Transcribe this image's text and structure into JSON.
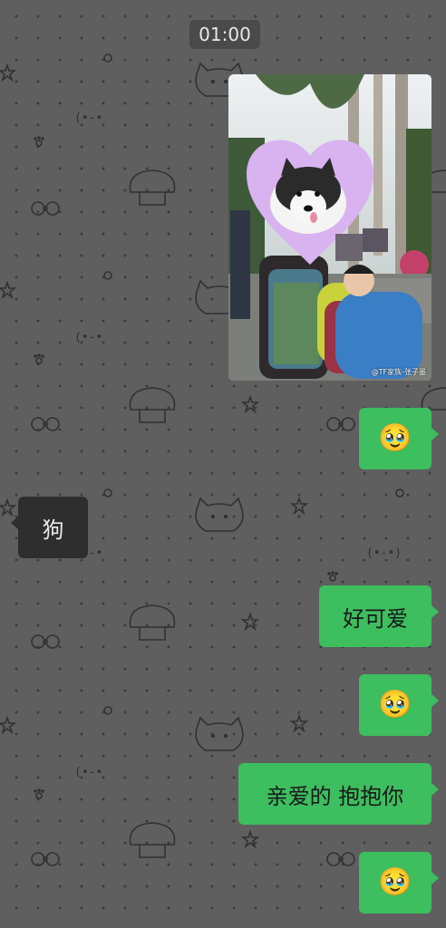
{
  "status": {
    "time": "01:00"
  },
  "photo": {
    "watermark": "@TF家族-张子墨"
  },
  "messages": [
    {
      "side": "me",
      "type": "emoji",
      "text": "🥹"
    },
    {
      "side": "other",
      "type": "text",
      "text": "狗"
    },
    {
      "side": "me",
      "type": "text",
      "text": "好可爱"
    },
    {
      "side": "me",
      "type": "emoji",
      "text": "🥹"
    },
    {
      "side": "me",
      "type": "text",
      "text": "亲爱的 抱抱你"
    },
    {
      "side": "me",
      "type": "emoji",
      "text": "🥹"
    }
  ],
  "colors": {
    "my_bubble": "#3dbe5f",
    "other_bubble": "#2e2e2e",
    "background": "#5f5f5f"
  }
}
